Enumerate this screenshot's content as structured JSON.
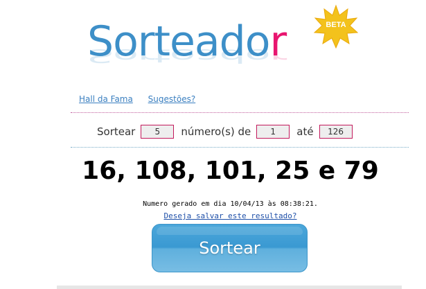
{
  "logo": {
    "text_main": "Sorteado",
    "text_accent": "r",
    "badge": "BETA"
  },
  "colors": {
    "logo_blue": "#3d8fc8",
    "logo_pink": "#e8156f",
    "link": "#3a7fc0",
    "badge_gold": "#f3c21c"
  },
  "links": {
    "hall": "Hall da Fama",
    "suggest": "Sugestões?"
  },
  "form": {
    "sortear_label": "Sortear",
    "count": "5",
    "numbers_label": "número(s) de",
    "from": "1",
    "to_label": "até",
    "to": "126"
  },
  "result": {
    "numbers": "16, 108, 101, 25 e 79"
  },
  "generated": "Numero gerado em dia 10/04/13 às 08:38:21.",
  "save_link": "Deseja salvar este resultado?",
  "button": {
    "label": "Sortear"
  }
}
